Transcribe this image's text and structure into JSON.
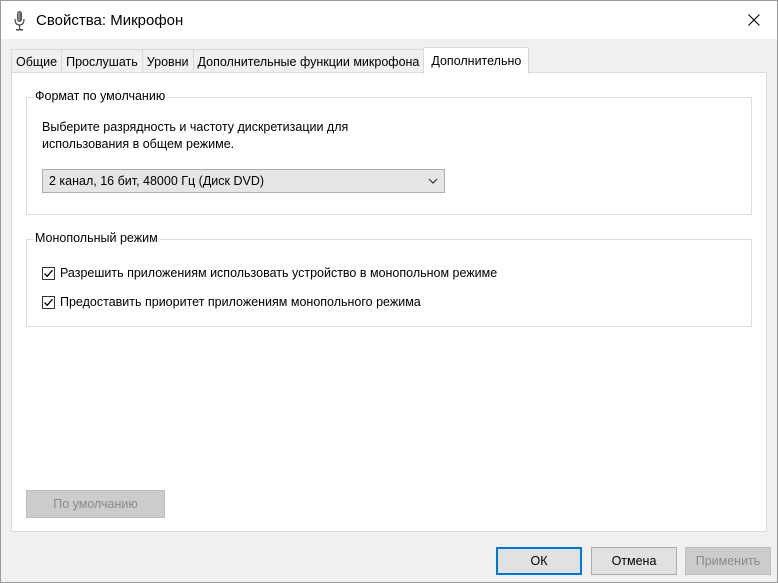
{
  "window": {
    "title": "Свойства: Микрофон",
    "close_glyph": "✕"
  },
  "tabs": [
    {
      "label": "Общие",
      "active": false
    },
    {
      "label": "Прослушать",
      "active": false
    },
    {
      "label": "Уровни",
      "active": false
    },
    {
      "label": "Дополнительные функции микрофона",
      "active": false
    },
    {
      "label": "Дополнительно",
      "active": true
    }
  ],
  "default_format": {
    "group_title": "Формат по умолчанию",
    "description_line1": "Выберите разрядность и частоту дискретизации для",
    "description_line2": "использования в общем режиме.",
    "selected_format": "2 канал, 16 бит, 48000 Гц (Диск DVD)"
  },
  "exclusive_mode": {
    "group_title": "Монопольный режим",
    "options": [
      {
        "label": "Разрешить приложениям использовать устройство в монопольном режиме",
        "checked": true
      },
      {
        "label": "Предоставить приоритет приложениям монопольного режима",
        "checked": true
      }
    ]
  },
  "buttons": {
    "restore_defaults": "По умолчанию",
    "ok": "ОК",
    "cancel": "Отмена",
    "apply": "Применить"
  },
  "colors": {
    "accent": "#0078d7",
    "disabled_text": "#8a8a8a"
  }
}
